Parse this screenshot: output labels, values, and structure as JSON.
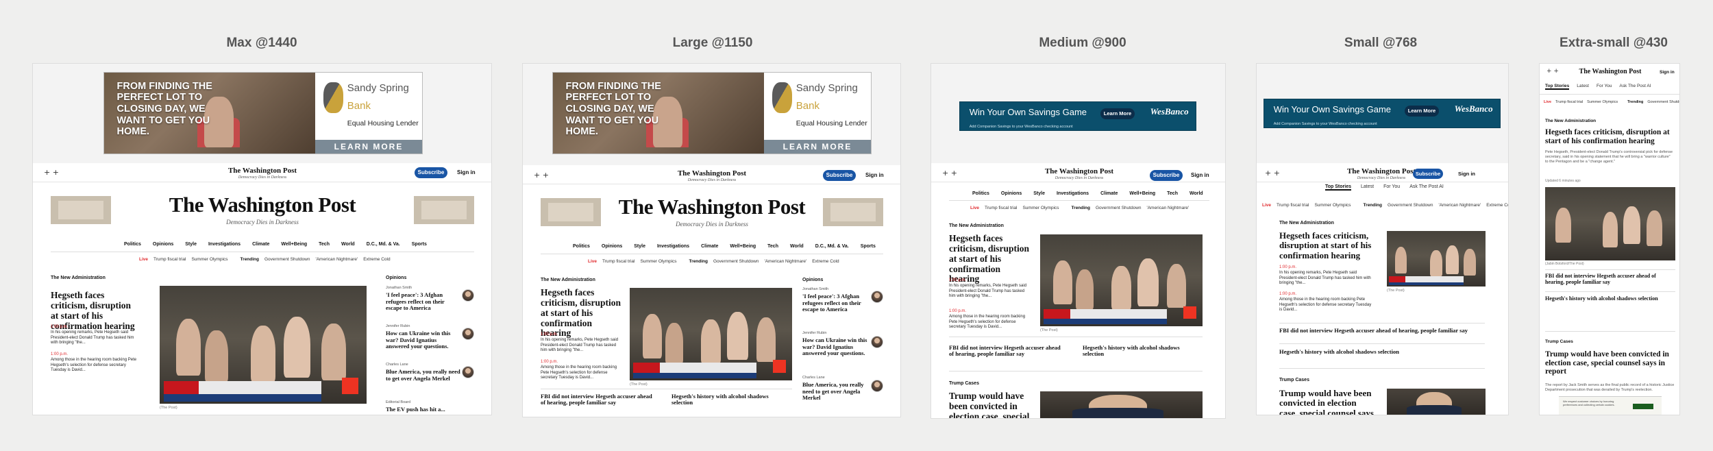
{
  "columns": [
    {
      "title": "Max @1440"
    },
    {
      "title": "Large @1150"
    },
    {
      "title": "Medium @900"
    },
    {
      "title": "Small @768"
    },
    {
      "title": "Extra-small @430"
    }
  ],
  "ads": {
    "sandy": {
      "headline": "FROM FINDING THE PERFECT LOT TO CLOSING DAY, WE WANT TO GET YOU HOME.",
      "bank_line1": "Sandy Spring",
      "bank_line2": "Bank",
      "equal": "Equal Housing Lender",
      "cta": "LEARN MORE"
    },
    "wes": {
      "text": "Win Your Own Savings Game",
      "cta": "Learn More",
      "brand": "WesBanco",
      "sub": "Add Companion Savings to your WesBanco checking account"
    }
  },
  "site": {
    "logo": "The Washington Post",
    "tagline": "Democracy Dies in Darkness",
    "subscribe": "Subscribe",
    "signin": "Sign in",
    "plus": "+  +",
    "nav": [
      "Politics",
      "Opinions",
      "Style",
      "Investigations",
      "Climate",
      "Well+Being",
      "Tech",
      "World",
      "D.C., Md. & Va.",
      "Sports"
    ],
    "nav_short": [
      "Politics",
      "Opinions",
      "Style",
      "Investigations",
      "Climate",
      "Well+Being",
      "Tech",
      "World"
    ],
    "live": "Live",
    "live_items": [
      "Trump fiscal trial",
      "Summer Olympics"
    ],
    "trending": "Trending",
    "trending_items": [
      "Government Shutdown",
      "'American Nightmare'",
      "Extreme Cold"
    ],
    "tabs": [
      "Top Stories",
      "Latest",
      "For You",
      "Ask The Post AI"
    ]
  },
  "story": {
    "kicker": "The New Administration",
    "headline": "Hegseth faces criticism, disruption at start of his confirmation hearing",
    "dek": "Pete Hegseth, President-elect Donald Trump's controversial pick for defense secretary, said in his opening statement that he will bring a \"warrior culture\" to the Pentagon and be a \"change agent.\"",
    "updated": "Updated 6 minutes ago",
    "bullets": [
      {
        "time": "1:00 p.m.",
        "text": "In his opening remarks, Pete Hegseth said President-elect Donald Trump has tasked him with bringing \"the..."
      },
      {
        "time": "1:00 p.m.",
        "text": "Among those in the hearing room backing Pete Hegseth's selection for defense secretary Tuesday is David..."
      }
    ],
    "credit": "(The Post)",
    "credit_xs": "(Jabin Botsford/The Post)",
    "lower_third_tag": "RIGHT NOW",
    "lower_third": "PENTAGON PICK HEGSETH FACES GRILLING BY SENATORS IN CONFIRMATION TEST",
    "lower_third_sub": "HEGSETH CONFIRMATION HEARING",
    "network": "CNBC",
    "sub_a": "FBI did not interview Hegseth accuser ahead of hearing, people familiar say",
    "sub_b": "Hegseth's history with alcohol shadows selection"
  },
  "story2": {
    "kicker": "Trump Cases",
    "headline": "Trump would have been convicted in election case, special counsel says in report",
    "dek": "The report by Jack Smith serves as the final public record of a historic Justice Department prosecution that was derailed by Trump's reelection."
  },
  "opinions": {
    "label": "Opinions",
    "items": [
      {
        "author": "Jonathan Smith",
        "headline": "'I feel peace': 3 Afghan refugees reflect on their escape to America"
      },
      {
        "author": "Jennifer Rubin",
        "headline": "How can Ukraine win this war? David Ignatius answered your questions."
      },
      {
        "author": "Charles Lane",
        "headline": "Blue America, you really need to get over Angela Merkel"
      },
      {
        "author": "Editorial Board",
        "headline": "The EV push has hit a..."
      }
    ]
  },
  "consent": {
    "text": "We respect customer choices by honoring preferences and collecting certain cookies."
  },
  "colors": {
    "subscribe": "#1955a5",
    "live": "#e0292d",
    "wesbanco": "#0b4f6c"
  }
}
